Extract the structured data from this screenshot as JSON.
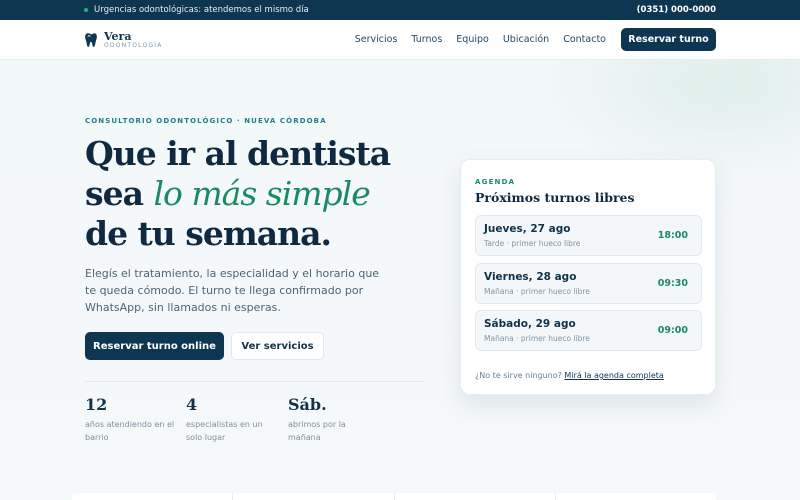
{
  "topbar": {
    "notice": "Urgencias odontológicas: atendemos el mismo día",
    "phone": "(0351) 000-0000",
    "dot_color": "#22b07d"
  },
  "brand": {
    "name": "Vera",
    "subtitle": "ODONTOLOGÍA",
    "icon": "tooth-icon"
  },
  "nav": {
    "items": [
      "Servicios",
      "Turnos",
      "Equipo",
      "Ubicación",
      "Contacto"
    ],
    "cta": "Reservar turno"
  },
  "hero": {
    "eyebrow": "CONSULTORIO ODONTOLÓGICO · NUEVA CÓRDOBA",
    "headline_line1": "Que ir al dentista",
    "headline_line2_start": "sea ",
    "headline_accent": "lo más simple",
    "headline_line3": "de tu semana.",
    "lead": "Elegís el tratamiento, la especialidad y el horario que te queda cómodo. El turno te llega confirmado por WhatsApp, sin llamados ni esperas.",
    "primary_button": "Reservar turno online",
    "secondary_button": "Ver servicios"
  },
  "stats": [
    {
      "value": "12",
      "label": "años atendiendo en el barrio"
    },
    {
      "value": "4",
      "label": "especialistas en un solo lugar"
    },
    {
      "value": "Sáb.",
      "label": "abrimos por la mañana"
    }
  ],
  "agenda": {
    "eyebrow": "AGENDA",
    "title": "Próximos turnos libres",
    "slots": [
      {
        "day": "Jueves, 27 ago",
        "note": "Tarde · primer hueco libre",
        "time": "18:00"
      },
      {
        "day": "Viernes, 28 ago",
        "note": "Mañana · primer hueco libre",
        "time": "09:30"
      },
      {
        "day": "Sábado, 29 ago",
        "note": "Mañana · primer hueco libre",
        "time": "09:00"
      }
    ],
    "footer_text": "¿No te sirve ninguno? ",
    "footer_link": "Mirá la agenda completa"
  },
  "colors": {
    "navy": "#0f3651",
    "accent_green": "#1b8a63",
    "teal_eyebrow": "#1d7f8a"
  }
}
